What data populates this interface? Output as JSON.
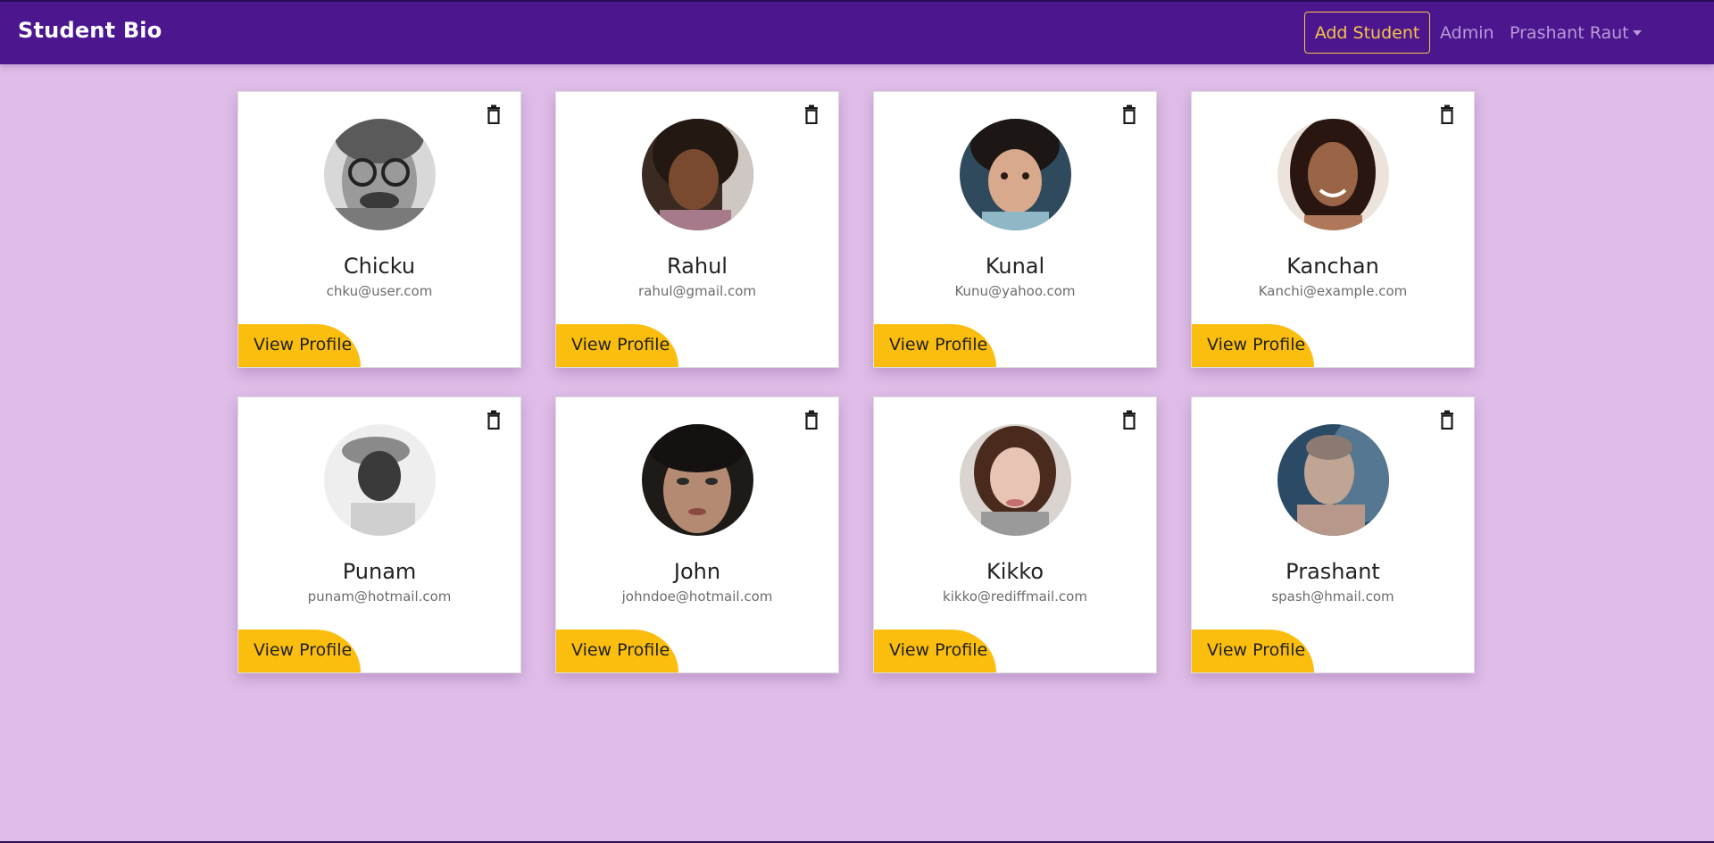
{
  "app": {
    "brand": "Student Bio"
  },
  "nav": {
    "add_student": "Add Student",
    "admin": "Admin",
    "user": "Prashant Raut"
  },
  "colors": {
    "navbar": "#4c168f",
    "background": "#dfbde8",
    "accent": "#fbbe0f"
  },
  "students": [
    {
      "name": "Chicku",
      "email": "chku@user.com",
      "view_label": "View Profile",
      "avatar": "avatar-grayscale-man-glasses"
    },
    {
      "name": "Rahul",
      "email": "rahul@gmail.com",
      "view_label": "View Profile",
      "avatar": "avatar-girl-curly-hair"
    },
    {
      "name": "Kunal",
      "email": "Kunu@yahoo.com",
      "view_label": "View Profile",
      "avatar": "avatar-toddler-curly-hair"
    },
    {
      "name": "Kanchan",
      "email": "Kanchi@example.com",
      "view_label": "View Profile",
      "avatar": "avatar-smiling-woman"
    },
    {
      "name": "Punam",
      "email": "punam@hotmail.com",
      "view_label": "View Profile",
      "avatar": "avatar-man-cap-grayscale"
    },
    {
      "name": "John",
      "email": "johndoe@hotmail.com",
      "view_label": "View Profile",
      "avatar": "avatar-woman-dark-hair"
    },
    {
      "name": "Kikko",
      "email": "kikko@rediffmail.com",
      "view_label": "View Profile",
      "avatar": "avatar-woman-scarf"
    },
    {
      "name": "Prashant",
      "email": "spash@hmail.com",
      "view_label": "View Profile",
      "avatar": "avatar-man-blue-smoke"
    }
  ]
}
